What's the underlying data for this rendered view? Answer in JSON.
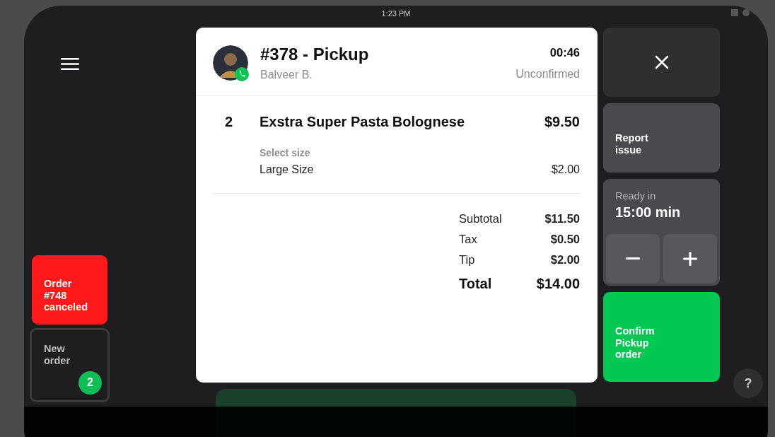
{
  "status_bar": {
    "time": "1:23 PM"
  },
  "side_tiles": [
    {
      "kind": "alert",
      "label": "Order #748 canceled"
    },
    {
      "kind": "queue",
      "label": "New order",
      "badge": "2"
    }
  ],
  "order": {
    "title": "#378 - Pickup",
    "customer": "Balveer B.",
    "timer": "00:46",
    "status": "Unconfirmed",
    "items": [
      {
        "qty": "2",
        "name": "Exstra Super Pasta Bolognese",
        "price": "$9.50",
        "options": [
          {
            "group": "Select size",
            "name": "Large Size",
            "price": "$2.00"
          }
        ]
      }
    ],
    "totals": [
      {
        "kind": "line",
        "label": "Subtotal",
        "value": "$11.50"
      },
      {
        "kind": "line",
        "label": "Tax",
        "value": "$0.50"
      },
      {
        "kind": "line",
        "label": "Tip",
        "value": "$2.00"
      },
      {
        "kind": "grand",
        "label": "Total",
        "value": "$14.00"
      }
    ]
  },
  "actions": {
    "report": "Report issue",
    "ready_label": "Ready in",
    "ready_value": "15:00 min",
    "confirm": "Confirm Pickup order"
  },
  "help": "?"
}
